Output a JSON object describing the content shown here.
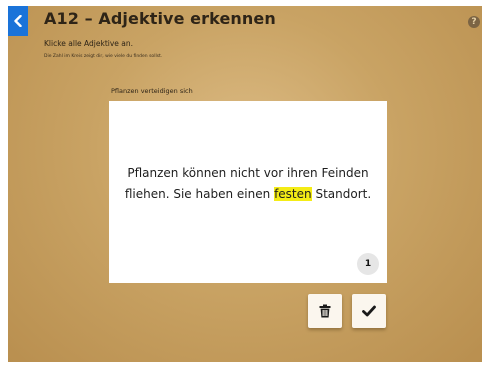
{
  "header": {
    "title": "A12 – Adjektive erkennen",
    "back_icon": "chevron-left-icon",
    "help_label": "?"
  },
  "instruction": "Klicke alle Adjektive an.",
  "hint": "Die Zahl im Kreis zeigt dir, wie viele du finden sollst.",
  "card": {
    "title": "Pflanzen verteidigen sich",
    "sentence1_words": [
      "Pflanzen",
      "können",
      "nicht",
      "vor",
      "ihren",
      "Feinden",
      "fliehen."
    ],
    "sentence2_pre": [
      "Sie",
      "haben",
      "einen"
    ],
    "selected_word": "festen",
    "sentence2_post": [
      "Standort."
    ],
    "counter": "1"
  },
  "actions": {
    "delete_icon": "trash-icon",
    "confirm_icon": "checkmark-icon"
  },
  "colors": {
    "accent_blue": "#1a73d9",
    "highlight_yellow": "#f4ec16",
    "background_gold": "#c9a364"
  }
}
